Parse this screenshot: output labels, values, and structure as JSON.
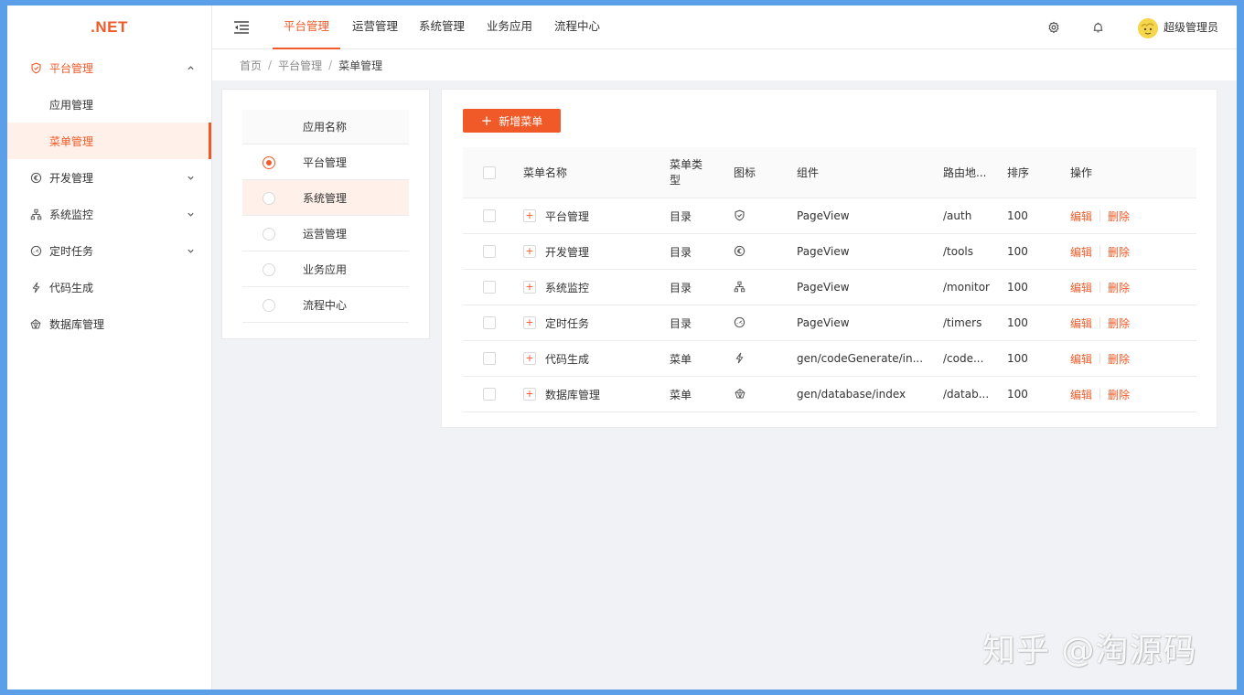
{
  "logo": ".NET",
  "sidebar": {
    "items": [
      {
        "label": "平台管理",
        "icon": "shield-icon",
        "arrow": "chevron-up-icon"
      },
      {
        "label": "应用管理"
      },
      {
        "label": "菜单管理"
      },
      {
        "label": "开发管理",
        "icon": "euro-circle-icon",
        "arrow": "chevron-down-icon"
      },
      {
        "label": "系统监控",
        "icon": "cluster-icon",
        "arrow": "chevron-down-icon"
      },
      {
        "label": "定时任务",
        "icon": "dashboard-icon",
        "arrow": "chevron-down-icon"
      },
      {
        "label": "代码生成",
        "icon": "thunderbolt-icon"
      },
      {
        "label": "数据库管理",
        "icon": "database-icon"
      }
    ]
  },
  "header": {
    "tabs": [
      "平台管理",
      "运营管理",
      "系统管理",
      "业务应用",
      "流程中心"
    ],
    "active_tab": "平台管理",
    "username": "超级管理员",
    "icons": [
      "menu-fold-icon",
      "gear-icon",
      "bell-icon",
      "avatar"
    ]
  },
  "breadcrumb": [
    "首页",
    "平台管理",
    "菜单管理"
  ],
  "app_list": {
    "header": "应用名称",
    "items": [
      "平台管理",
      "系统管理",
      "运营管理",
      "业务应用",
      "流程中心"
    ],
    "selected": "平台管理"
  },
  "menu_table": {
    "add_button": "新增菜单",
    "columns": [
      "菜单名称",
      "菜单类型",
      "图标",
      "组件",
      "路由地...",
      "排序",
      "操作"
    ],
    "rows": [
      {
        "name": "平台管理",
        "type": "目录",
        "icon": "shield-icon",
        "component": "PageView",
        "route": "/auth",
        "sort": "100"
      },
      {
        "name": "开发管理",
        "type": "目录",
        "icon": "euro-circle-icon",
        "component": "PageView",
        "route": "/tools",
        "sort": "100"
      },
      {
        "name": "系统监控",
        "type": "目录",
        "icon": "cluster-icon",
        "component": "PageView",
        "route": "/monitor",
        "sort": "100"
      },
      {
        "name": "定时任务",
        "type": "目录",
        "icon": "dashboard-icon",
        "component": "PageView",
        "route": "/timers",
        "sort": "100"
      },
      {
        "name": "代码生成",
        "type": "菜单",
        "icon": "thunderbolt-icon",
        "component": "gen/codeGenerate/in...",
        "route": "/code...",
        "sort": "100"
      },
      {
        "name": "数据库管理",
        "type": "菜单",
        "icon": "database-icon",
        "component": "gen/database/index",
        "route": "/datab...",
        "sort": "100"
      }
    ],
    "edit_label": "编辑",
    "delete_label": "删除"
  },
  "watermark": "知乎 @淘源码",
  "colors": {
    "accent": "#f05a28",
    "accent_light": "#fff1ea",
    "background": "#f0f2f5"
  }
}
